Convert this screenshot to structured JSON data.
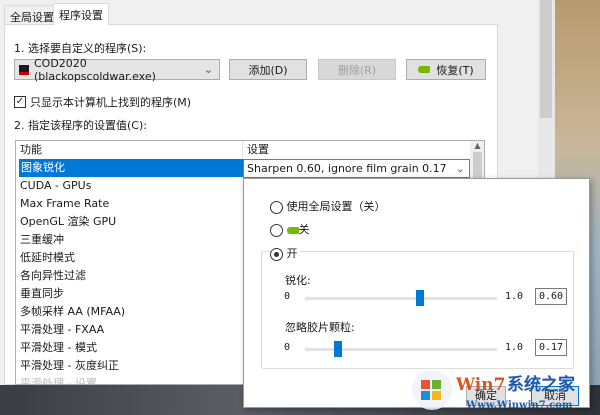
{
  "tabs": [
    {
      "label": "全局设置"
    },
    {
      "label": "程序设置"
    }
  ],
  "step1_label": "1. 选择要自定义的程序(S):",
  "program_combo": {
    "value": "COD2020 (blackopscoldwar.exe)"
  },
  "buttons": {
    "add": "添加(D)",
    "remove": "删除(R)",
    "restore": "恢复(T)"
  },
  "show_only_checkbox": {
    "label": "只显示本计算机上找到的程序(M)",
    "checked": true
  },
  "step2_label": "2. 指定该程序的设置值(C):",
  "table": {
    "headers": [
      "功能",
      "设置"
    ],
    "rows": [
      "图象锐化",
      "CUDA - GPUs",
      "Max Frame Rate",
      "OpenGL 渲染 GPU",
      "三重缓冲",
      "低延时模式",
      "各向异性过滤",
      "垂直同步",
      "多帧采样 AA (MFAA)",
      "平滑处理 - FXAA",
      "平滑处理 - 模式",
      "平滑处理 - 灰度纠正",
      "平滑处理 - 设置"
    ],
    "selected_value": "Sharpen 0.60, ignore film grain 0.17"
  },
  "popup": {
    "options": [
      "使用全局设置（关）",
      "关",
      "开"
    ],
    "selected": "开",
    "sharpen": {
      "label": "锐化:",
      "min": "0",
      "max": "1.0",
      "value": "0.60",
      "fraction": 0.6
    },
    "grain": {
      "label": "忽略胶片颗粒:",
      "min": "0",
      "max": "1.0",
      "value": "0.17",
      "fraction": 0.17
    },
    "ok": "确定",
    "cancel": "取消"
  },
  "watermark": {
    "title": "Win7系统之家",
    "url": "Www.Winwin7.com"
  }
}
